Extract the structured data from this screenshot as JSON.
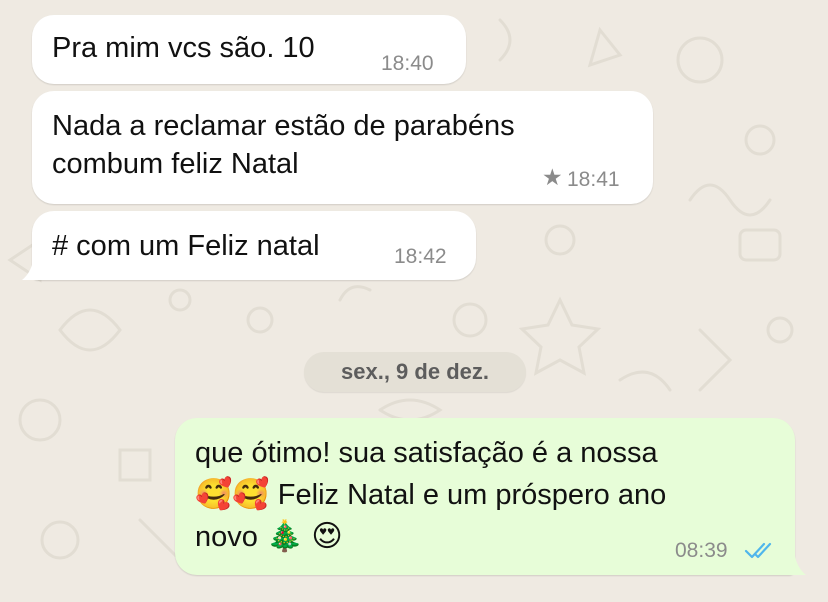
{
  "messages": [
    {
      "direction": "incoming",
      "text": "Pra mim vcs são. 10",
      "time": "18:40"
    },
    {
      "direction": "incoming",
      "lines": [
        "Nada a reclamar estão de parabéns",
        "combum feliz Natal"
      ],
      "time": "18:41",
      "starred": true
    },
    {
      "direction": "incoming",
      "text": "# com um Feliz natal",
      "time": "18:42"
    },
    {
      "direction": "outgoing",
      "line1": "que ótimo! sua satisfação é a nossa",
      "line2_emoji": "🥰🥰",
      "line2_text": "Feliz Natal e um próspero ano",
      "line3_text": "novo",
      "line3_emoji_tree": "🎄",
      "line3_emoji_eyes": "😍",
      "time": "08:39",
      "status": "read"
    }
  ],
  "date_separator": "sex., 9 de dez.",
  "colors": {
    "background": "#efeae2",
    "incoming_bubble": "#ffffff",
    "outgoing_bubble": "#e7fdd8",
    "read_ticks": "#4fb6ec",
    "timestamp": "#8b8b8b"
  }
}
